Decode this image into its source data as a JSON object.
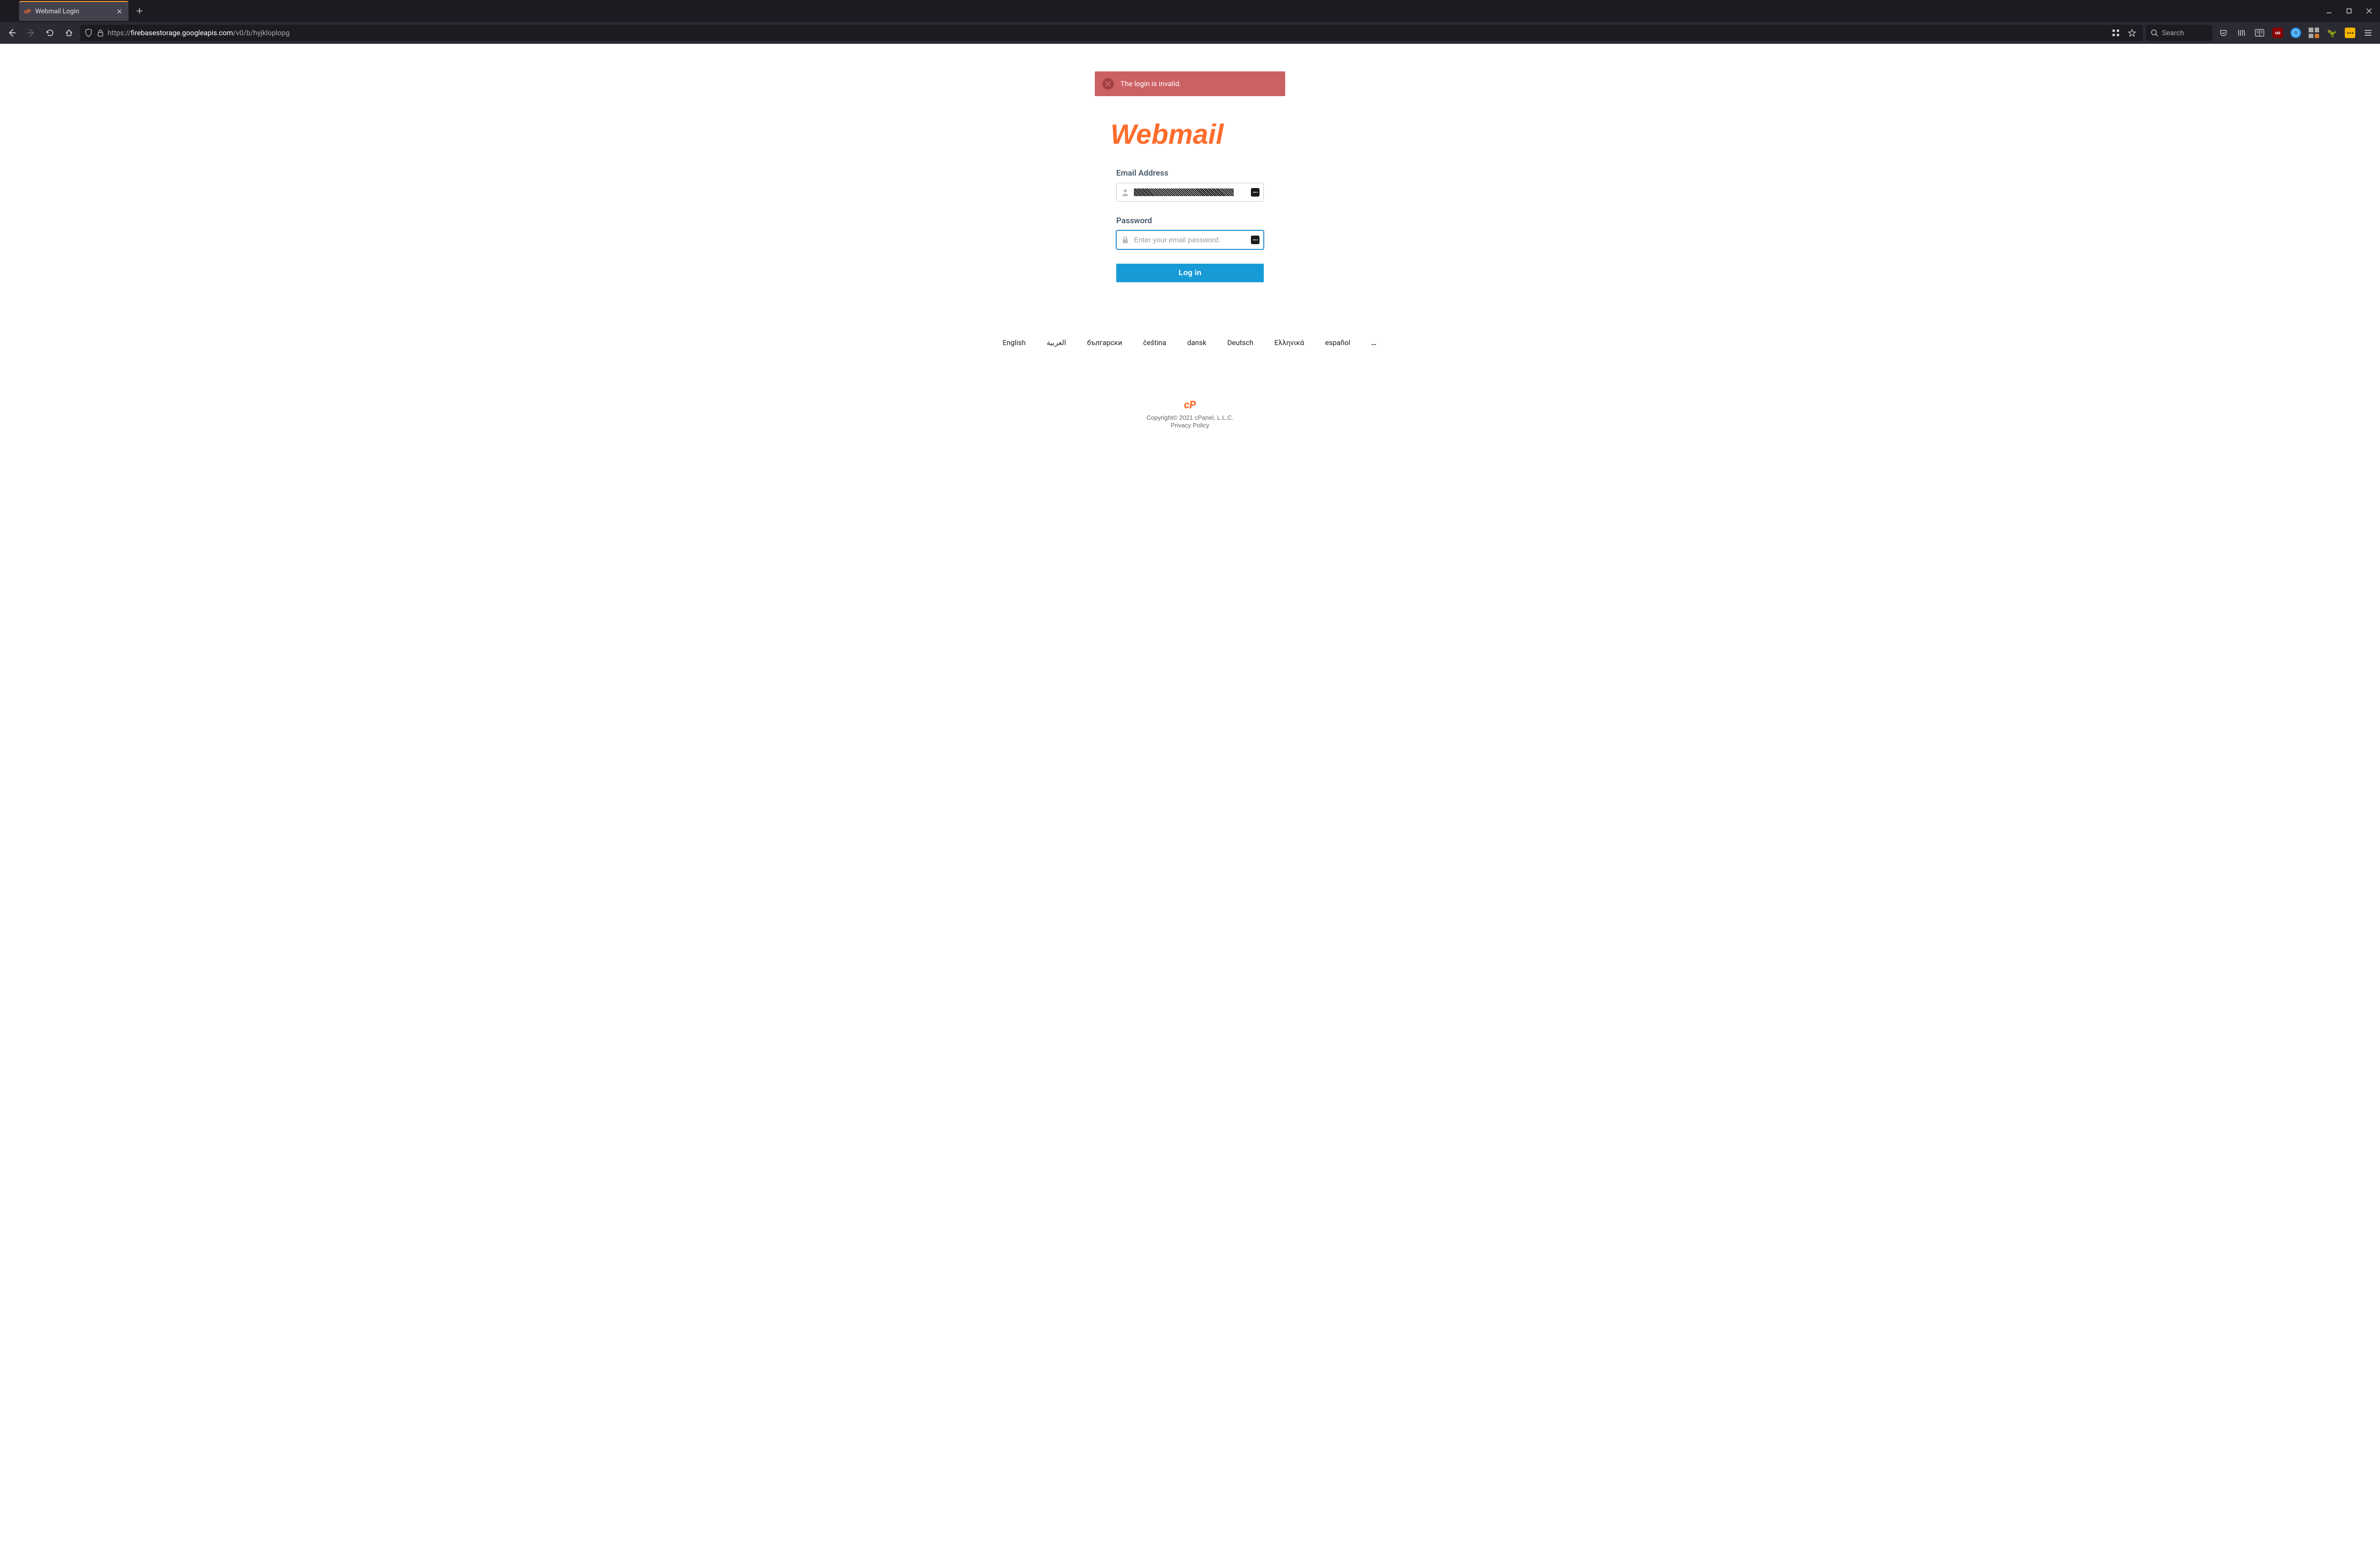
{
  "browser": {
    "tab_title": "Webmail Login",
    "url_proto": "https://",
    "url_host": "firebasestorage.googleapis.com",
    "url_path": "/v0/b/hyjkloplopg",
    "search_placeholder": "Search"
  },
  "alert": {
    "message": "The login is invalid."
  },
  "logo": {
    "text": "Webmail"
  },
  "form": {
    "email_label": "Email Address",
    "password_label": "Password",
    "password_placeholder": "Enter your email password.",
    "login_button": "Log in"
  },
  "languages": [
    "English",
    "العربية",
    "български",
    "čeština",
    "dansk",
    "Deutsch",
    "Ελληνικά",
    "español"
  ],
  "more_languages": "…",
  "footer": {
    "copyright": "Copyright© 2021 cPanel, L.L.C.",
    "privacy": "Privacy Policy"
  },
  "icons": {
    "favicon": "cP",
    "cp_footer": "cP",
    "ublock": "uo"
  }
}
